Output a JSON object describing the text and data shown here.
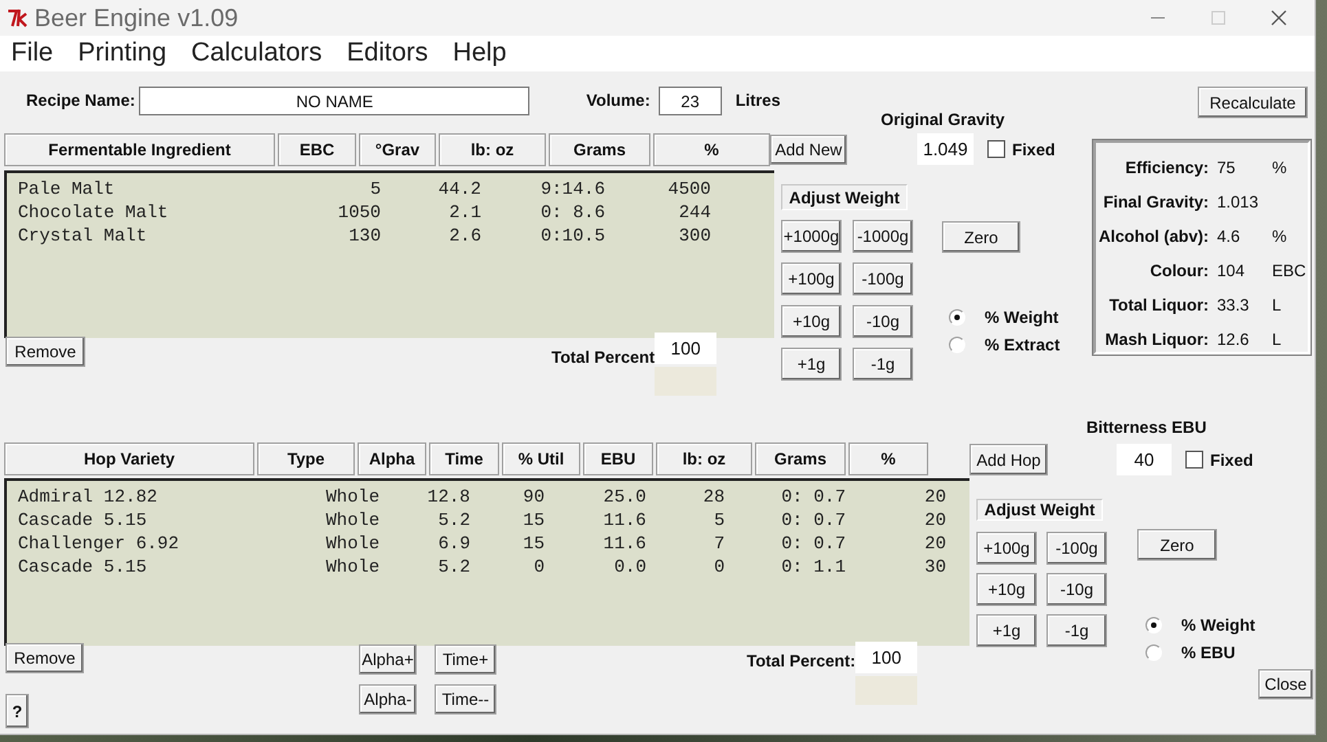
{
  "window": {
    "title": "Beer Engine v1.09"
  },
  "menu": [
    "File",
    "Printing",
    "Calculators",
    "Editors",
    "Help"
  ],
  "recipe": {
    "name_label": "Recipe Name:",
    "name": "NO NAME",
    "volume_label": "Volume:",
    "volume": "23",
    "volume_unit": "Litres"
  },
  "original_gravity": {
    "label": "Original Gravity",
    "value": "1.049",
    "fixed": {
      "label": "Fixed",
      "checked": false
    }
  },
  "recalculate_button": "Recalculate",
  "fermentables": {
    "columns": [
      "Fermentable Ingredient",
      "EBC",
      "°Grav",
      "lb: oz",
      "Grams",
      "%"
    ],
    "rows": [
      {
        "cells": [
          "Pale Malt",
          "5",
          "44.2",
          "9:14.6",
          "4500"
        ]
      },
      {
        "cells": [
          "Chocolate Malt",
          "1050",
          "2.1",
          "0: 8.6",
          "244"
        ]
      },
      {
        "cells": [
          "Crystal Malt",
          "130",
          "2.6",
          "0:10.5",
          "300"
        ]
      }
    ],
    "add_button": "Add New",
    "remove_button": "Remove",
    "total_label": "Total Percent",
    "total": "100"
  },
  "fermentable_adjust": {
    "title": "Adjust Weight",
    "buttons": [
      "+1000g",
      "-1000g",
      "+100g",
      "-100g",
      "+10g",
      "-10g",
      "+1g",
      "-1g"
    ],
    "zero_button": "Zero",
    "modes": [
      {
        "label": "% Weight",
        "selected": true
      },
      {
        "label": "% Extract",
        "selected": false
      }
    ]
  },
  "stats": [
    {
      "label": "Efficiency:",
      "value": "75",
      "unit": "%"
    },
    {
      "label": "Final Gravity:",
      "value": "1.013"
    },
    {
      "label": "Alcohol (abv):",
      "value": "4.6",
      "unit": "%"
    },
    {
      "label": "Colour:",
      "value": "104",
      "unit": "EBC"
    },
    {
      "label": "Total Liquor:",
      "value": "33.3",
      "unit": "L"
    },
    {
      "label": "Mash Liquor:",
      "value": "12.6",
      "unit": "L"
    }
  ],
  "bitterness": {
    "label": "Bitterness EBU",
    "value": "40",
    "fixed": {
      "label": "Fixed",
      "checked": false
    }
  },
  "hops": {
    "columns": [
      "Hop Variety",
      "Type",
      "Alpha",
      "Time",
      "% Util",
      "EBU",
      "lb: oz",
      "Grams",
      "%"
    ],
    "rows": [
      {
        "cells": [
          "Admiral 12.82",
          "Whole",
          "",
          "12.8",
          "90",
          "25.0",
          "28",
          "0: 0.7",
          "20"
        ]
      },
      {
        "cells": [
          "Cascade 5.15",
          "Whole",
          "",
          "5.2",
          "15",
          "11.6",
          "5",
          "0: 0.7",
          "20"
        ]
      },
      {
        "cells": [
          "Challenger 6.92",
          "Whole",
          "",
          "6.9",
          "15",
          "11.6",
          "7",
          "0: 0.7",
          "20"
        ]
      },
      {
        "cells": [
          "Cascade 5.15",
          "Whole",
          "",
          "5.2",
          "0",
          "0.0",
          "0",
          "0: 1.1",
          "30"
        ]
      }
    ],
    "add_button": "Add Hop",
    "remove_button": "Remove",
    "alpha_buttons": [
      "Alpha+",
      "Alpha-"
    ],
    "time_buttons": [
      "Time+",
      "Time--"
    ],
    "total_label": "Total Percent:",
    "total": "100"
  },
  "hop_adjust": {
    "title": "Adjust Weight",
    "buttons": [
      "+100g",
      "-100g",
      "+10g",
      "-10g",
      "+1g",
      "-1g"
    ],
    "zero_button": "Zero",
    "modes": [
      {
        "label": "% Weight",
        "selected": true
      },
      {
        "label": "% EBU",
        "selected": false
      }
    ]
  },
  "help_button": "?",
  "close_button": "Close"
}
